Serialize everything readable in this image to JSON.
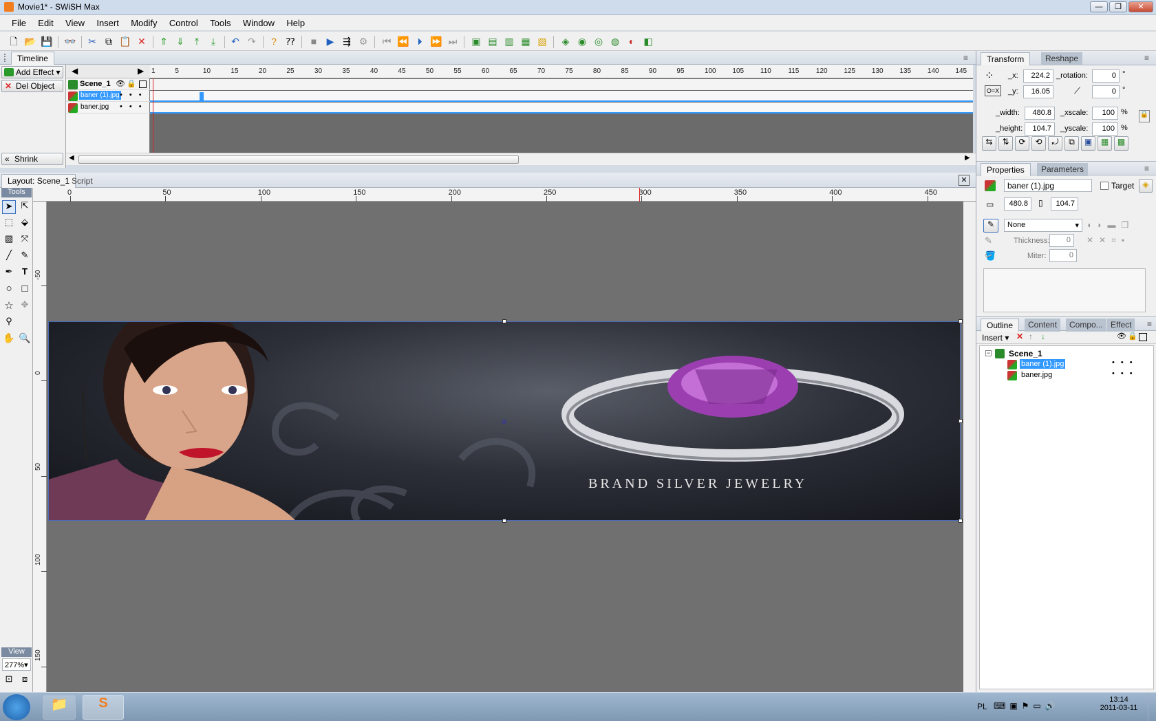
{
  "window": {
    "title": "Movie1* - SWiSH Max"
  },
  "menu": [
    "File",
    "Edit",
    "View",
    "Insert",
    "Modify",
    "Control",
    "Tools",
    "Window",
    "Help"
  ],
  "timeline": {
    "tab": "Timeline",
    "add_effect": "Add Effect",
    "del_object": "Del Object",
    "shrink": "Shrink",
    "ruler_labels": [
      "1",
      "5",
      "10",
      "15",
      "20",
      "25",
      "30",
      "35",
      "40",
      "45",
      "50",
      "55",
      "60",
      "65",
      "70",
      "75",
      "80",
      "85",
      "90",
      "95",
      "100",
      "105",
      "110",
      "115",
      "120",
      "125",
      "130",
      "135",
      "140",
      "145"
    ],
    "rows": [
      {
        "name": "Scene_1"
      },
      {
        "name": "baner (1).jpg"
      },
      {
        "name": "baner.jpg"
      }
    ]
  },
  "layout": {
    "tab": "Layout: Scene_1",
    "script_tab": "Script",
    "tools_label": "Tools",
    "view_label": "View",
    "zoom": "277%",
    "hruler": [
      "0",
      "50",
      "100",
      "150",
      "200",
      "250",
      "300",
      "350",
      "400",
      "450"
    ],
    "vruler": [
      "-50",
      "0",
      "50",
      "100",
      "150"
    ],
    "banner_text": "BRAND SILVER JEWELRY"
  },
  "transform": {
    "tab": "Transform",
    "reshape_tab": "Reshape",
    "x_label": "_x:",
    "x": "224.2",
    "y_label": "_y:",
    "y": "16.05",
    "rotation_label": "_rotation:",
    "rotation": "0",
    "skew": "0",
    "width_label": "_width:",
    "width": "480.8",
    "height_label": "_height:",
    "height": "104.7",
    "xscale_label": "_xscale:",
    "xscale": "100",
    "yscale_label": "_yscale:",
    "yscale": "100",
    "pct": "%",
    "deg": "°"
  },
  "properties": {
    "tab": "Properties",
    "parameters_tab": "Parameters",
    "name": "baner (1).jpg",
    "target_label": "Target",
    "w": "480.8",
    "h": "104.7",
    "line": "None",
    "thickness_label": "Thickness:",
    "thickness": "0",
    "miter_label": "Miter:",
    "miter": "0"
  },
  "outline": {
    "tabs": [
      "Outline",
      "Content",
      "Compo...",
      "Effect"
    ],
    "insert_label": "Insert",
    "tree": [
      {
        "name": "Scene_1"
      },
      {
        "name": "baner (1).jpg"
      },
      {
        "name": "baner.jpg"
      }
    ]
  },
  "taskbar": {
    "lang": "PL",
    "time": "13:14",
    "date": "2011-03-11"
  },
  "colors": {
    "accent": "#3399ff",
    "canvas": "#707070"
  }
}
